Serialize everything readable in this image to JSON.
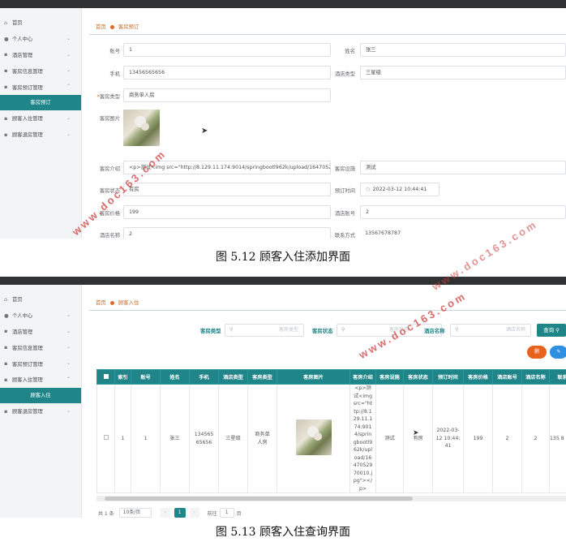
{
  "sidebar": {
    "items": [
      {
        "icon": "home-icon",
        "label": "首页",
        "has_children": false
      },
      {
        "icon": "user-icon",
        "label": "个人中心",
        "has_children": true
      },
      {
        "icon": "list-icon",
        "label": "酒店管理",
        "has_children": true
      },
      {
        "icon": "list-icon",
        "label": "客房信息管理",
        "has_children": true
      },
      {
        "icon": "list-icon",
        "label": "客房预订管理",
        "has_children": true
      }
    ],
    "active_sub_1": "客房预订",
    "items_after_1": [
      {
        "icon": "list-icon",
        "label": "顾客入住管理"
      },
      {
        "icon": "list-icon",
        "label": "顾客退房管理"
      }
    ],
    "items_before_2": [
      {
        "icon": "home-icon",
        "label": "首页"
      },
      {
        "icon": "user-icon",
        "label": "个人中心"
      },
      {
        "icon": "list-icon",
        "label": "酒店管理"
      },
      {
        "icon": "list-icon",
        "label": "客房信息管理"
      },
      {
        "icon": "list-icon",
        "label": "客房预订管理"
      },
      {
        "icon": "list-icon",
        "label": "顾客入住管理"
      }
    ],
    "active_sub_2": "顾客入住",
    "items_after_2": [
      {
        "icon": "list-icon",
        "label": "顾客退房管理"
      }
    ]
  },
  "form": {
    "breadcrumb_home": "首页",
    "breadcrumb_current": "客房预订",
    "fields": {
      "account_label": "账号",
      "account": "1",
      "name_label": "姓名",
      "name": "张三",
      "phone_label": "手机",
      "phone": "13456565656",
      "hotel_type_label": "酒店类型",
      "hotel_type": "三星级",
      "room_type_label": "客房类型",
      "room_type": "商务单人房",
      "room_image_label": "客房图片",
      "room_intro_label": "客房介绍",
      "room_intro": "<p>测试<img src=\"http://8.129.11.174:9014/springbootl962k/upload/1647052970010.",
      "facilities_label": "客房设施",
      "facilities": "测试",
      "room_status_label": "客房状态",
      "room_status": "有房",
      "booking_time_label": "预订时间",
      "booking_time": "2022-03-12 10:44:41",
      "room_price_label": "客房价格",
      "room_price": "199",
      "hotel_account_label": "酒店账号",
      "hotel_account": "2",
      "hotel_name_label": "酒店名称",
      "hotel_name": "2",
      "contact_label": "联系方式",
      "contact": "13567678787"
    },
    "required_mark": "*"
  },
  "caption_1": "图 5.12 顾客入住添加界面",
  "list": {
    "breadcrumb_home": "首页",
    "breadcrumb_current": "顾客入住",
    "search": [
      {
        "label": "客房类型",
        "placeholder": "客房类型"
      },
      {
        "label": "客房状态",
        "placeholder": "客房状态"
      },
      {
        "label": "酒店名称",
        "placeholder": "酒店名称"
      }
    ],
    "query_button": "查询",
    "delete_button": "删",
    "blue_button": "✎",
    "columns": [
      "索引",
      "账号",
      "姓名",
      "手机",
      "酒店类型",
      "客房类型",
      "客房图片",
      "客房介绍",
      "客房设施",
      "客房状态",
      "预订时间",
      "客房价格",
      "酒店账号",
      "酒店名称",
      "联系"
    ],
    "rows": [
      {
        "index": "1",
        "account": "1",
        "name": "张三",
        "phone": "13456565656",
        "hotel_type": "三星级",
        "room_type": "商务单人房",
        "intro": "<p>测试<img src=\"http://8.129.11.174:9014/springbootl962k/upload/1647052970010.jpg\"></p>",
        "facilities": "测试",
        "status": "有房",
        "booking_time": "2022-03-12 10:44:41",
        "price": "199",
        "hotel_account": "2",
        "hotel_name": "2",
        "contact": "135 8"
      }
    ],
    "pager": {
      "total": "共 1 条",
      "page_size": "10条/页",
      "current": "1",
      "goto": "前往",
      "goto_value": "1",
      "page_unit": "页"
    }
  },
  "caption_2": "图 5.13 顾客入住查询界面",
  "watermarks": [
    "www.doc163.com",
    "www.doc163.com",
    "www.doc163.com"
  ],
  "colors": {
    "accent": "#1f8589",
    "breadcrumb": "#c86b2a",
    "watermark": "#cc3b3b",
    "delete": "#e8621e"
  }
}
